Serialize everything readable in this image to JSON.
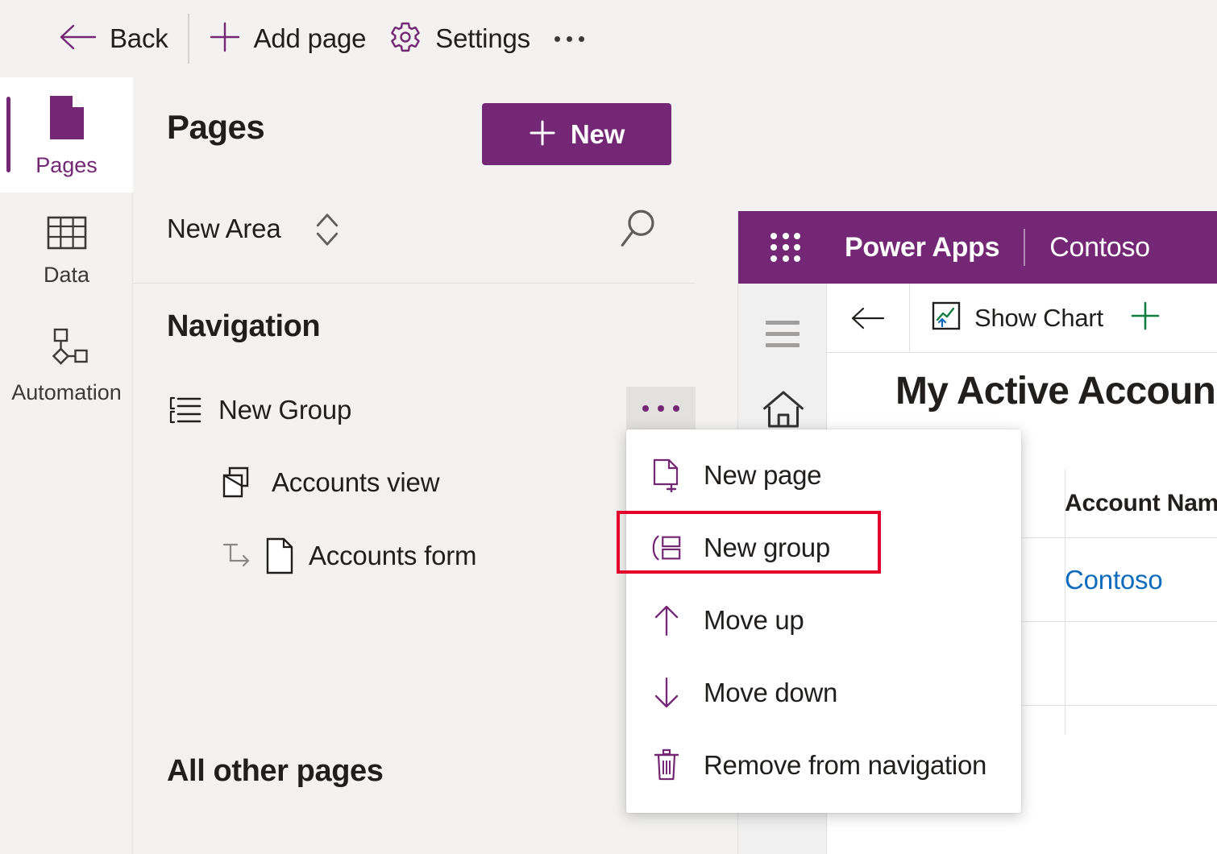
{
  "toolbar": {
    "back_label": "Back",
    "add_page_label": "Add page",
    "settings_label": "Settings",
    "overflow_label": "More commands",
    "icons": {
      "back": "arrow-left-icon",
      "add": "plus-icon",
      "settings": "gear-icon",
      "overflow": "ellipsis-icon"
    }
  },
  "rail": {
    "items": [
      {
        "label": "Pages",
        "icon": "page-icon",
        "selected": true
      },
      {
        "label": "Data",
        "icon": "table-icon",
        "selected": false
      },
      {
        "label": "Automation",
        "icon": "flow-icon",
        "selected": false
      }
    ]
  },
  "pages_panel": {
    "title": "Pages",
    "new_button_label": "New",
    "area_name": "New Area",
    "area_switch_icon": "up-down-chevron-icon",
    "search_icon": "search-icon",
    "navigation_title": "Navigation",
    "tree": [
      {
        "label": "New Group",
        "icon": "group-list-icon",
        "level": 0
      },
      {
        "label": "Accounts view",
        "icon": "view-icon",
        "level": 1
      },
      {
        "label": "Accounts form",
        "icon": "form-page-icon",
        "level": 2
      }
    ],
    "group_more_label": "More options",
    "other_pages_title": "All other pages"
  },
  "context_menu": {
    "items": [
      {
        "label": "New page",
        "icon": "new-page-icon",
        "highlighted": false
      },
      {
        "label": "New group",
        "icon": "new-group-icon",
        "highlighted": true
      },
      {
        "label": "Move up",
        "icon": "arrow-up-icon",
        "highlighted": false
      },
      {
        "label": "Move down",
        "icon": "arrow-down-icon",
        "highlighted": false
      },
      {
        "label": "Remove from navigation",
        "icon": "trash-icon",
        "highlighted": false
      }
    ]
  },
  "preview": {
    "waffle_icon": "app-launcher-icon",
    "brand": "Power Apps",
    "environment": "Contoso",
    "hamburger_icon": "hamburger-icon",
    "home_icon": "home-icon",
    "back_icon": "arrow-left-icon",
    "show_chart_label": "Show Chart",
    "show_chart_icon": "chart-icon",
    "new_record_icon": "plus-icon",
    "view_title": "My Active Accoun",
    "grid": {
      "columns": [
        "Account Name"
      ],
      "sort_indicator": "chevron-up-icon",
      "rows": [
        {
          "account_name": "Contoso"
        }
      ]
    }
  },
  "colors": {
    "accent_purple": "#742774",
    "highlight_red": "#e3002b",
    "link_blue": "#0f6cbd",
    "panel_bg": "#f3f2f1"
  }
}
